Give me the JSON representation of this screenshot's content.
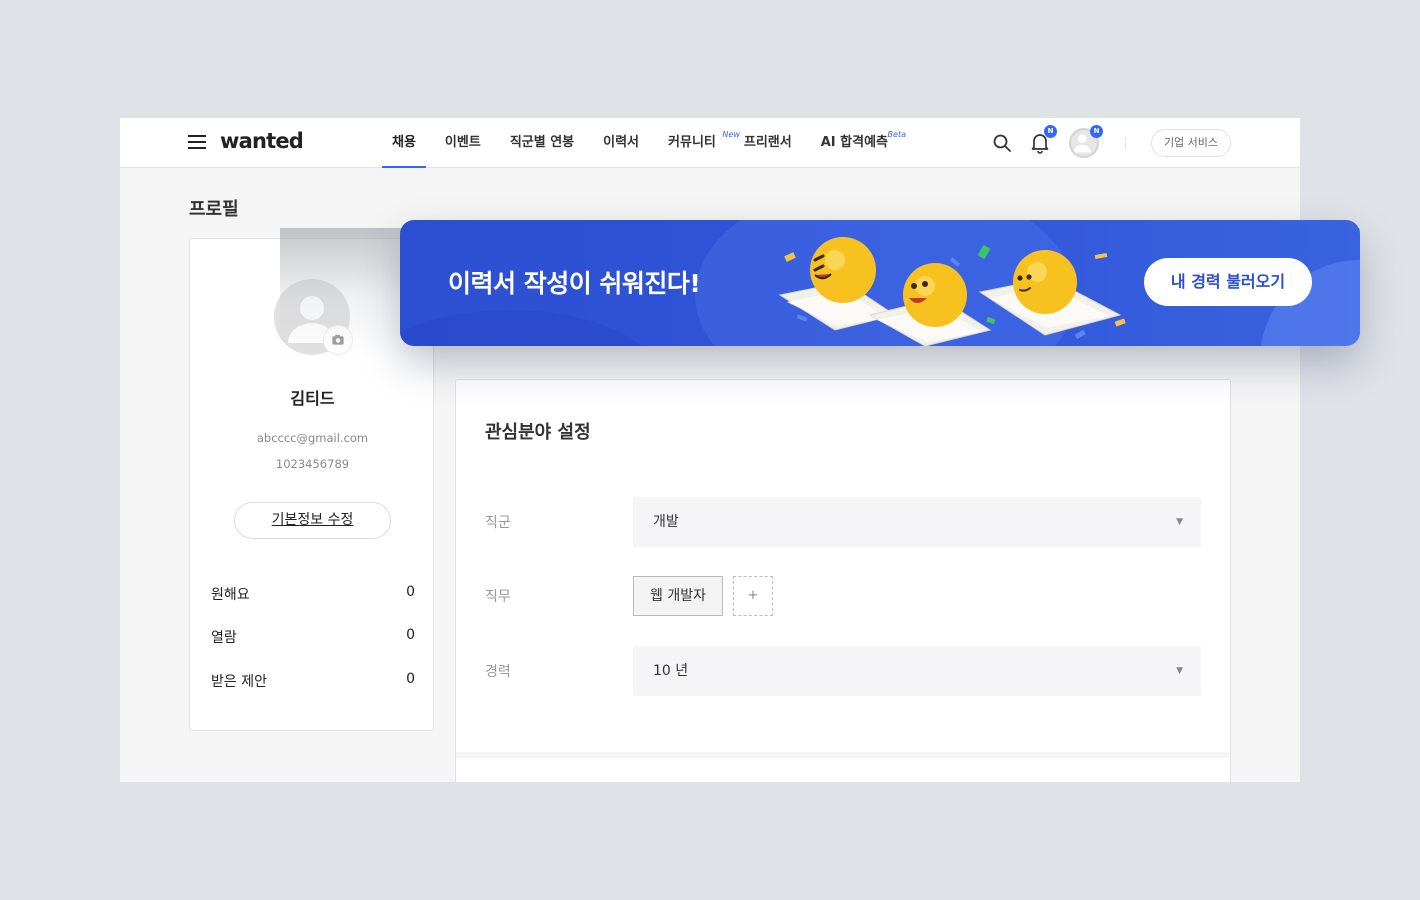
{
  "header": {
    "logo": "wanted",
    "nav": [
      {
        "label": "채용",
        "active": true
      },
      {
        "label": "이벤트"
      },
      {
        "label": "직군별 연봉"
      },
      {
        "label": "이력서"
      },
      {
        "label": "커뮤니티",
        "badge": "New"
      },
      {
        "label": "프리랜서"
      },
      {
        "label": "AI 합격예측",
        "badge": "Beta"
      }
    ],
    "notification_badge": "N",
    "avatar_badge": "N",
    "corporate_button": "기업 서비스"
  },
  "page": {
    "title": "프로필"
  },
  "profile": {
    "name": "김티드",
    "email": "abcccc@gmail.com",
    "phone": "1023456789",
    "edit_button": "기본정보 수정",
    "stats": [
      {
        "label": "원해요",
        "value": "0"
      },
      {
        "label": "열람",
        "value": "0"
      },
      {
        "label": "받은 제안",
        "value": "0"
      }
    ]
  },
  "interests": {
    "title": "관심분야 설정",
    "job_group_label": "직군",
    "job_group_value": "개발",
    "job_label": "직무",
    "job_tags": [
      "웹 개발자"
    ],
    "add_tag": "+",
    "career_label": "경력",
    "career_value": "10 년",
    "caret": "▼"
  },
  "banner": {
    "text": "이력서 작성이 쉬워진다!",
    "button": "내 경력 불러오기"
  },
  "colors": {
    "accent": "#3366ff",
    "banner": "#2d4fd2"
  }
}
